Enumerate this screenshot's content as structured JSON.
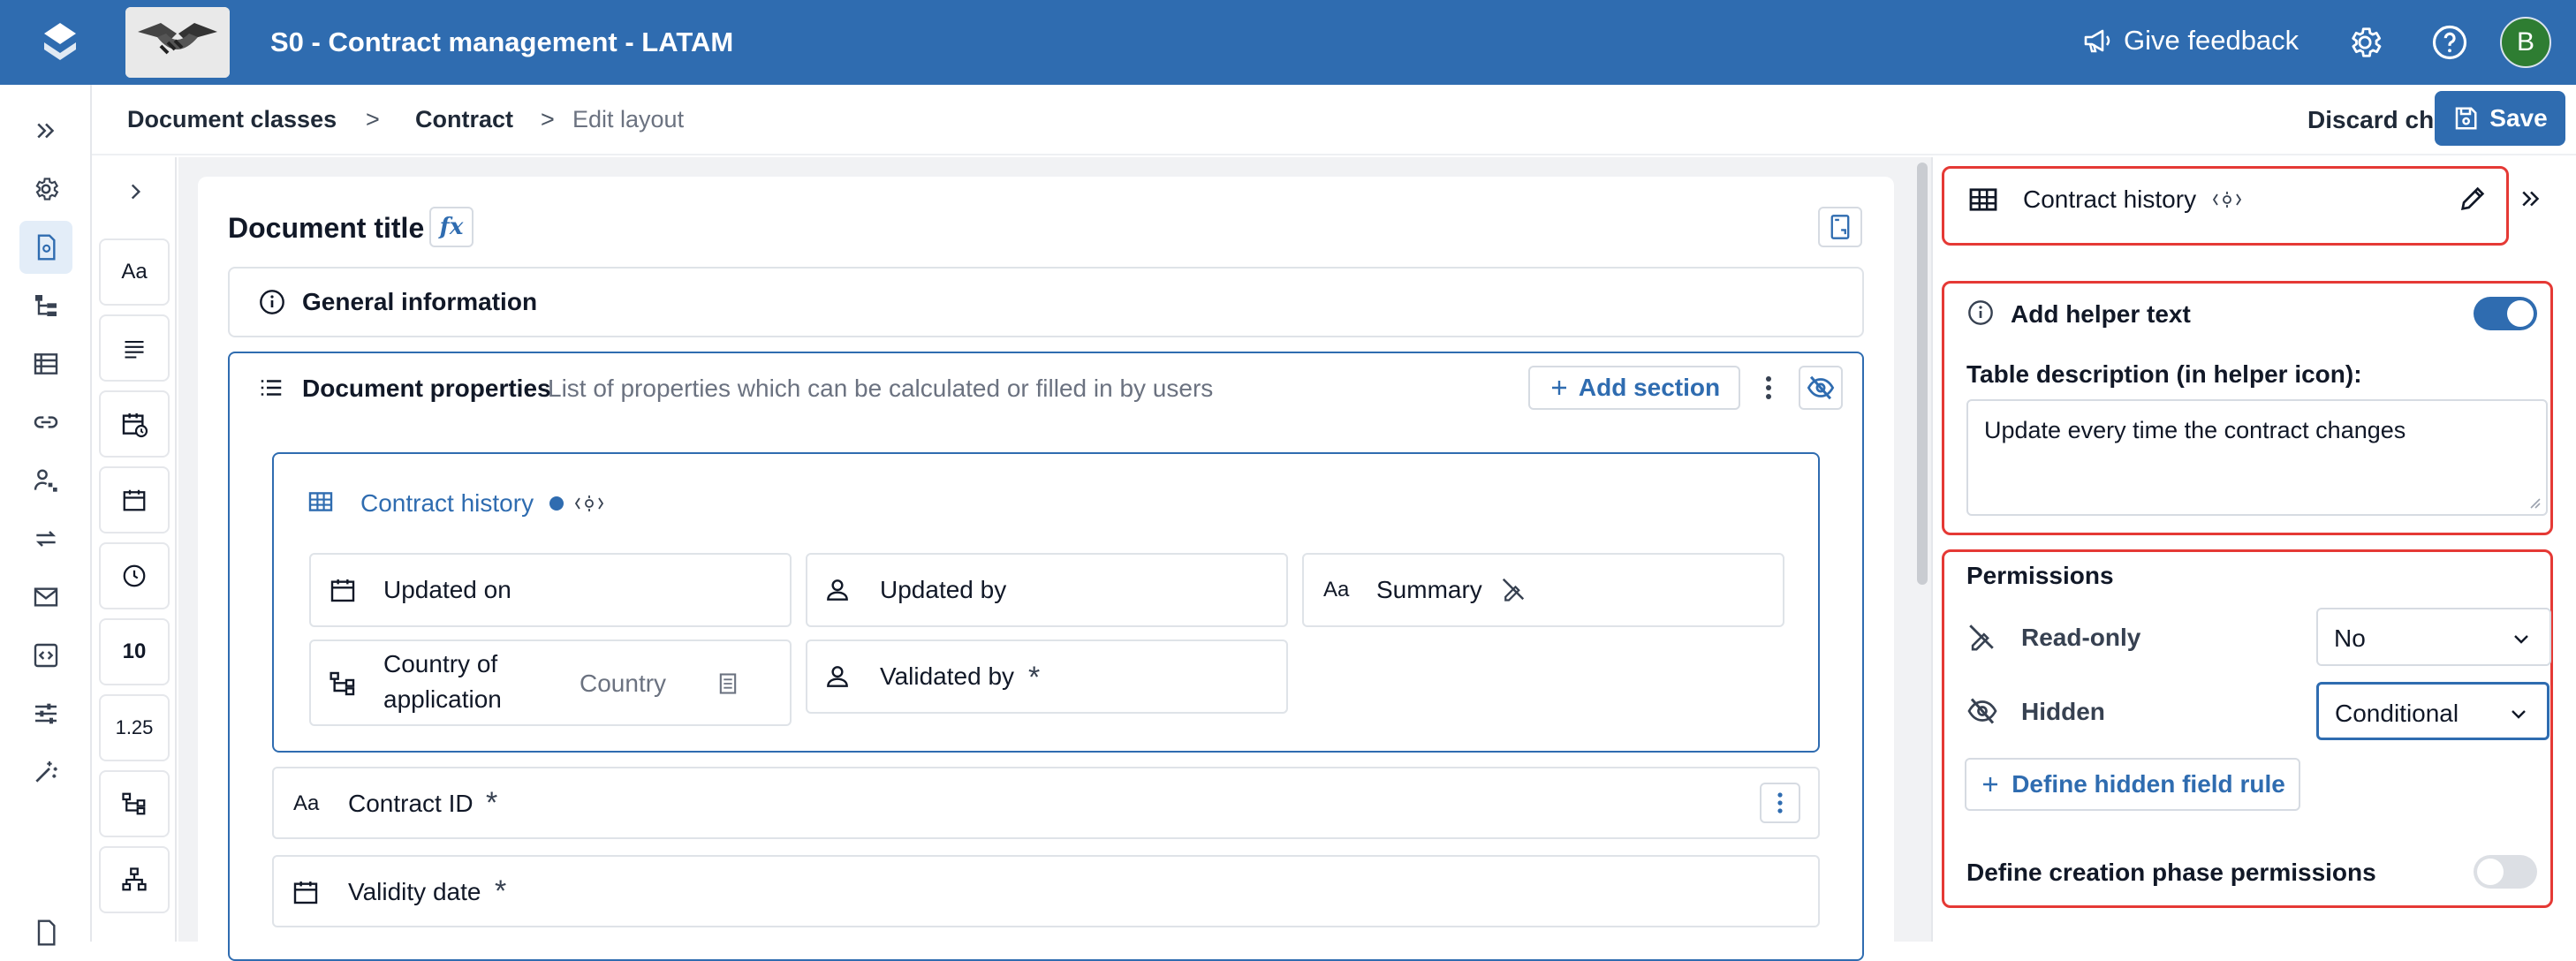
{
  "header": {
    "app_title": "S0 - Contract management - LATAM",
    "feedback_label": "Give feedback",
    "avatar_initial": "B",
    "brand_color": "#2f6cb0"
  },
  "breadcrumb": {
    "items": [
      "Document classes",
      "Contract"
    ],
    "separator": ">",
    "current": "Edit layout"
  },
  "actions": {
    "discard_label": "Discard changes",
    "save_label": "Save"
  },
  "palette": {
    "tiles": [
      "Aa",
      "paragraph-icon",
      "date-time-icon",
      "calendar-icon",
      "clock-icon",
      "10",
      "1.25",
      "hierarchy-icon",
      "org-chart-icon"
    ]
  },
  "document": {
    "title": "Document title",
    "fx_label": "fx",
    "general_section": "General information",
    "properties_section": {
      "title": "Document properties",
      "description": "List of properties which can be calculated or filled in by users",
      "add_section_label": "Add section"
    },
    "table": {
      "title": "Contract history",
      "fields": [
        {
          "label": "Updated on",
          "icon": "calendar-icon"
        },
        {
          "label": "Updated by",
          "icon": "person-icon"
        },
        {
          "label": "Summary",
          "icon": "text-icon",
          "badge": "read-only-icon"
        },
        {
          "label": "Country of application",
          "line1": "Country of",
          "line2": "application",
          "icon": "hierarchy-icon",
          "hint": "Country"
        },
        {
          "label": "Validated by",
          "icon": "person-icon",
          "required": "*"
        }
      ]
    },
    "rows": [
      {
        "label": "Contract ID",
        "prefix": "Aa",
        "required": "*"
      },
      {
        "label": "Validity date",
        "icon": "calendar-icon",
        "required": "*"
      }
    ]
  },
  "panel": {
    "title": "Contract history",
    "helper": {
      "label": "Add helper text",
      "enabled": true,
      "description_label": "Table description (in helper icon):",
      "description_value": "Update every time the contract changes"
    },
    "permissions": {
      "heading": "Permissions",
      "readonly_label": "Read-only",
      "readonly_value": "No",
      "hidden_label": "Hidden",
      "hidden_value": "Conditional",
      "define_rule_label": "Define hidden field rule",
      "creation_phase_label": "Define creation phase permissions",
      "creation_phase_enabled": false
    },
    "highlight_color": "#e53935"
  }
}
